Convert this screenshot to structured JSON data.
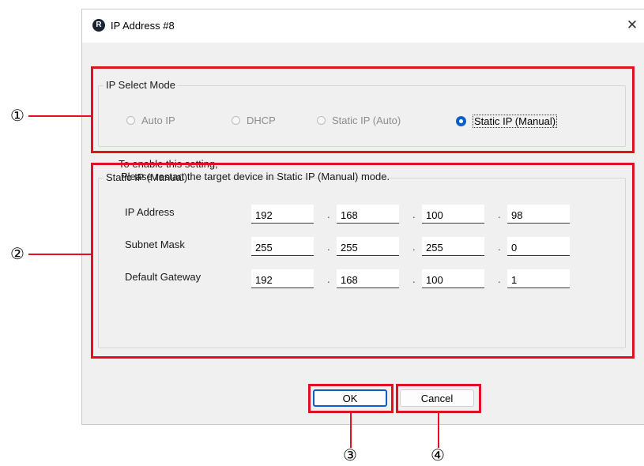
{
  "window": {
    "title": "IP Address #8",
    "app_icon": "app-logo-icon",
    "close_glyph": "✕"
  },
  "ip_select_mode": {
    "label": "IP Select Mode",
    "options": [
      {
        "label": "Auto IP",
        "enabled": false,
        "selected": false
      },
      {
        "label": "DHCP",
        "enabled": false,
        "selected": false
      },
      {
        "label": "Static IP (Auto)",
        "enabled": false,
        "selected": false
      },
      {
        "label": "Static IP (Manual)",
        "enabled": true,
        "selected": true
      }
    ]
  },
  "static_ip": {
    "label": "Static IP (Manual)",
    "separator": ".",
    "rows": [
      {
        "label": "IP Address",
        "octets": [
          "192",
          "168",
          "100",
          "98"
        ]
      },
      {
        "label": "Subnet Mask",
        "octets": [
          "255",
          "255",
          "255",
          "0"
        ]
      },
      {
        "label": "Default Gateway",
        "octets": [
          "192",
          "168",
          "100",
          "1"
        ]
      }
    ],
    "note_line1": "To enable this setting,",
    "note_line2": "Please restart the target device in Static IP (Manual) mode."
  },
  "buttons": {
    "ok": "OK",
    "cancel": "Cancel"
  },
  "callouts": [
    "①",
    "②",
    "③",
    "④"
  ],
  "colors": {
    "highlight": "#e0121e",
    "accent": "#0a5fc8",
    "dialog_bg": "#f0f0f0"
  }
}
